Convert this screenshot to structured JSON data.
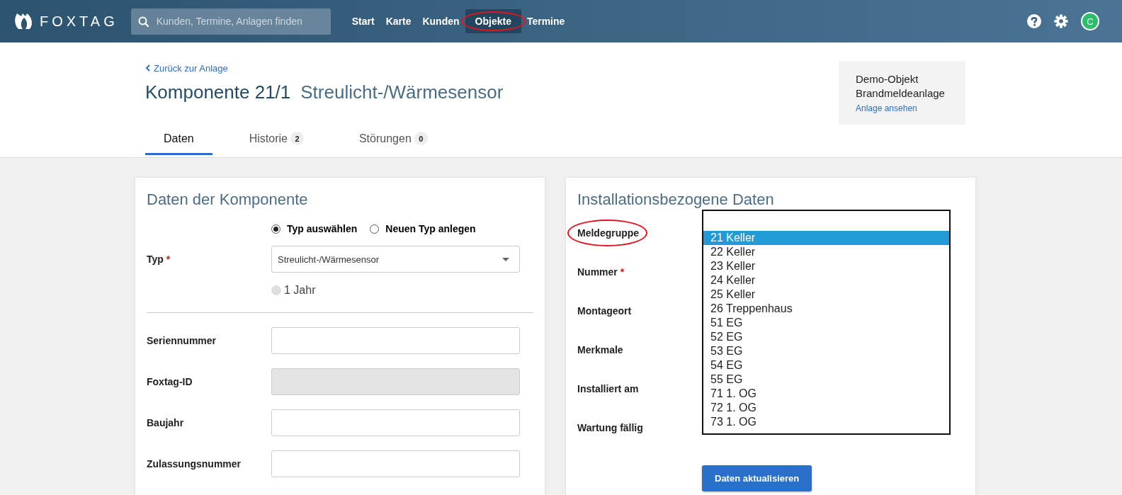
{
  "top_bar": {
    "logo": "FOXTAG",
    "search": {
      "placeholder": "Kunden, Termine, Anlagen finden"
    },
    "nav": [
      {
        "label": "Start",
        "selected": false,
        "annotated": false
      },
      {
        "label": "Karte",
        "selected": false,
        "annotated": false
      },
      {
        "label": "Kunden",
        "selected": false,
        "annotated": false
      },
      {
        "label": "Objekte",
        "selected": true,
        "annotated": true
      },
      {
        "label": "Termine",
        "selected": false,
        "annotated": false
      }
    ],
    "avatar": "C"
  },
  "header": {
    "back_link": "Zurück zur Anlage",
    "title": "Komponente 21/1",
    "subtitle": "Streulicht-/Wärmesensor",
    "tabs": [
      {
        "label": "Daten",
        "selected": true
      },
      {
        "label": "Historie",
        "badge": "2",
        "selected": false
      },
      {
        "label": "Störungen",
        "badge": "0",
        "selected": false
      }
    ]
  },
  "object_card": {
    "name": "Demo-Objekt",
    "type": "Brandmeldeanlage",
    "link": "Anlage ansehen"
  },
  "component_panel": {
    "title": "Daten der Komponente",
    "type_mode": [
      {
        "label": "Typ auswählen",
        "selected": true
      },
      {
        "label": "Neuen Typ anlegen",
        "selected": false
      }
    ],
    "type_field": {
      "label": "Typ",
      "required_mark": "*",
      "value": "Streulicht-/Wärmesensor"
    },
    "interval": {
      "label": "1 Jahr",
      "disabled": true
    },
    "fields": [
      {
        "label": "Seriennummer",
        "disabled": false
      },
      {
        "label": "Foxtag-ID",
        "disabled": true
      },
      {
        "label": "Baujahr",
        "disabled": false
      },
      {
        "label": "Zulassungsnummer",
        "disabled": false
      }
    ]
  },
  "installation_panel": {
    "title": "Installationsbezogene Daten",
    "fields": [
      {
        "label": "Meldegruppe",
        "annotated": true
      },
      {
        "label": "Nummer",
        "required_mark": "*",
        "annotated": false
      },
      {
        "label": "Montageort",
        "annotated": false
      },
      {
        "label": "Merkmale",
        "annotated": false
      },
      {
        "label": "Installiert am",
        "annotated": false
      },
      {
        "label": "Wartung fällig",
        "annotated": false
      }
    ],
    "dropdown": {
      "options": [
        {
          "label": "21 Keller",
          "selected": true
        },
        {
          "label": "22 Keller",
          "selected": false
        },
        {
          "label": "23 Keller",
          "selected": false
        },
        {
          "label": "24 Keller",
          "selected": false
        },
        {
          "label": "25 Keller",
          "selected": false
        },
        {
          "label": "26 Treppenhaus",
          "selected": false
        },
        {
          "label": "51 EG",
          "selected": false
        },
        {
          "label": "52 EG",
          "selected": false
        },
        {
          "label": "53 EG",
          "selected": false
        },
        {
          "label": "54 EG",
          "selected": false
        },
        {
          "label": "55 EG",
          "selected": false
        },
        {
          "label": "71 1. OG",
          "selected": false
        },
        {
          "label": "72 1. OG",
          "selected": false
        },
        {
          "label": "73 1. OG",
          "selected": false
        }
      ]
    },
    "button": "Daten aktualisieren"
  }
}
